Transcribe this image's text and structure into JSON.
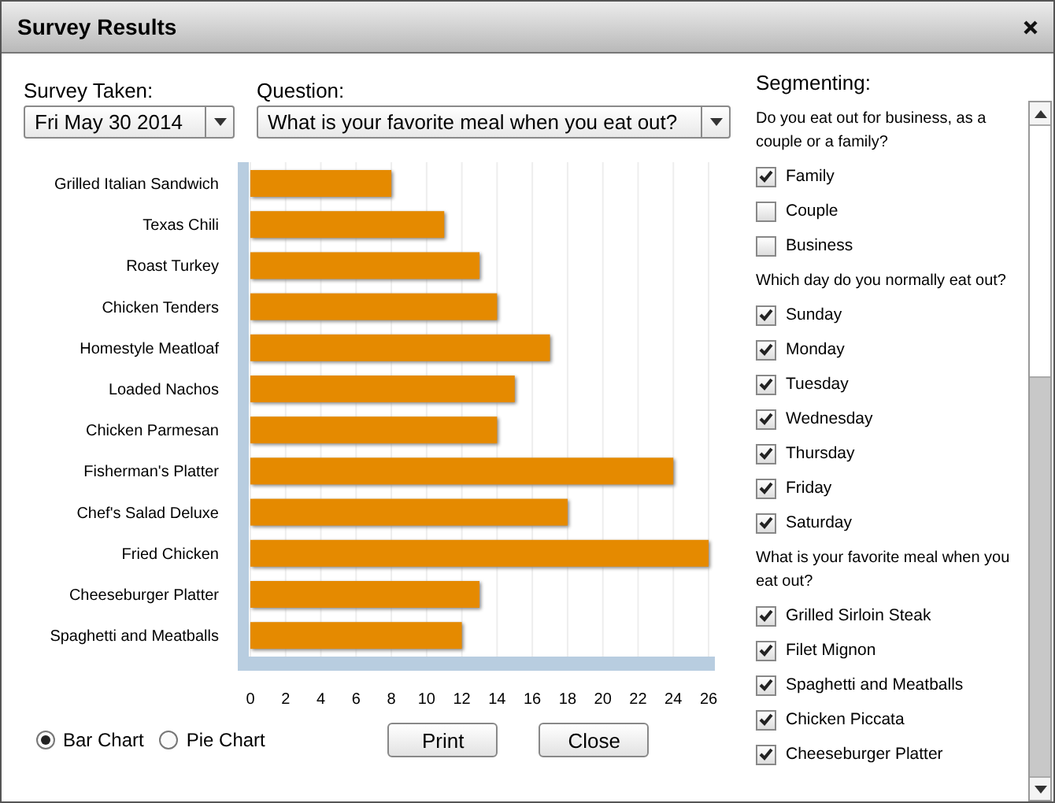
{
  "window": {
    "title": "Survey Results"
  },
  "survey_taken": {
    "label": "Survey Taken:",
    "value": "Fri May 30 2014"
  },
  "question": {
    "label": "Question:",
    "value": "What is your favorite meal when you eat out?"
  },
  "chart_data": {
    "type": "bar",
    "orientation": "horizontal",
    "categories": [
      "Grilled Italian Sandwich",
      "Texas Chili",
      "Roast Turkey",
      "Chicken Tenders",
      "Homestyle Meatloaf",
      "Loaded Nachos",
      "Chicken Parmesan",
      "Fisherman's Platter",
      "Chef's Salad Deluxe",
      "Fried Chicken",
      "Cheeseburger Platter",
      "Spaghetti and Meatballs"
    ],
    "series": [
      {
        "color": "#e58a00",
        "values": [
          8,
          11,
          13,
          14,
          17,
          15,
          14,
          24,
          18,
          26,
          13,
          12
        ]
      }
    ],
    "xlim": [
      0,
      26
    ],
    "grid": true,
    "xticks": [
      0,
      2,
      4,
      6,
      8,
      10,
      12,
      14,
      16,
      18,
      20,
      22,
      24,
      26
    ]
  },
  "chart_type": [
    {
      "label": "Bar Chart",
      "selected": true
    },
    {
      "label": "Pie Chart",
      "selected": false
    }
  ],
  "buttons": [
    "Print",
    "Close"
  ],
  "segmenting": {
    "label": "Segmenting:",
    "groups": [
      {
        "question": "Do you eat out for business, as a couple or a family?",
        "options": [
          {
            "label": "Family",
            "checked": true
          },
          {
            "label": "Couple",
            "checked": false
          },
          {
            "label": "Business",
            "checked": false
          }
        ]
      },
      {
        "question": "Which day do you normally eat out?",
        "options": [
          {
            "label": "Sunday",
            "checked": true
          },
          {
            "label": "Monday",
            "checked": true
          },
          {
            "label": "Tuesday",
            "checked": true
          },
          {
            "label": "Wednesday",
            "checked": true
          },
          {
            "label": "Thursday",
            "checked": true
          },
          {
            "label": "Friday",
            "checked": true
          },
          {
            "label": "Saturday",
            "checked": true
          }
        ]
      },
      {
        "question": "What is your favorite meal when you eat out?",
        "options": [
          {
            "label": "Grilled Sirloin Steak",
            "checked": true
          },
          {
            "label": "Filet Mignon",
            "checked": true
          },
          {
            "label": "Spaghetti and Meatballs",
            "checked": true
          },
          {
            "label": "Chicken Piccata",
            "checked": true
          },
          {
            "label": "Cheeseburger Platter",
            "checked": true
          }
        ]
      }
    ]
  }
}
